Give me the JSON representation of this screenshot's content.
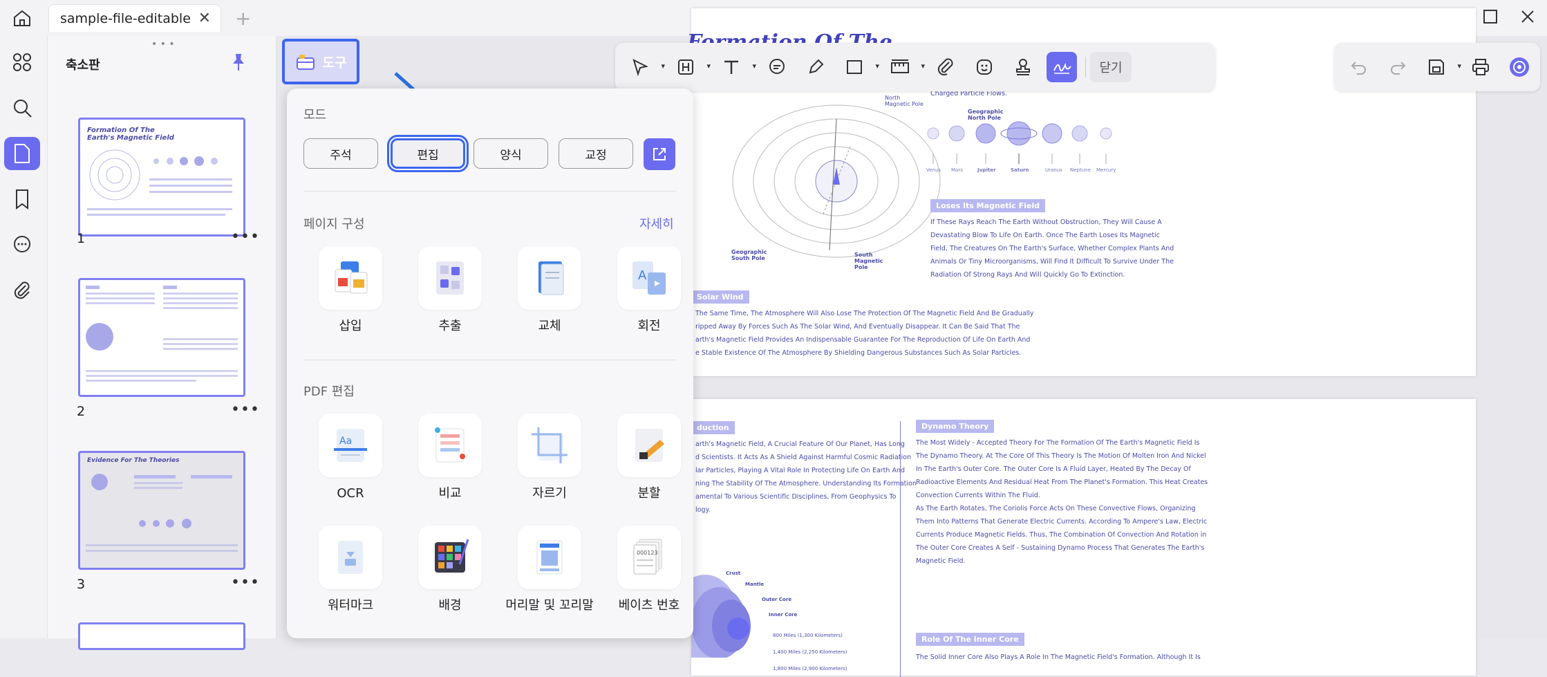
{
  "tab": {
    "title": "sample-file-editable"
  },
  "sidebar": {
    "title": "축소판"
  },
  "thumbnails": [
    {
      "num": "1"
    },
    {
      "num": "2"
    },
    {
      "num": "3"
    }
  ],
  "tools_button": {
    "label": "도구"
  },
  "toolbar": {
    "close_label": "닫기"
  },
  "popup": {
    "mode_title": "모드",
    "modes": [
      "주석",
      "편집",
      "양식",
      "교정"
    ],
    "page_section": "페이지 구성",
    "details_link": "자세히",
    "page_items": [
      "삽입",
      "추출",
      "교체",
      "회전"
    ],
    "pdf_section": "PDF 편집",
    "pdf_items": [
      "OCR",
      "비교",
      "자르기",
      "분할"
    ],
    "pdf_items2": [
      "워터마크",
      "배경",
      "머리말 및 꼬리말",
      "베이츠 번호"
    ]
  },
  "doc": {
    "page1_title": "Formation Of The",
    "north_pole": "North\nMagnetic Pole",
    "geo_north": "Geographic\nNorth Pole",
    "geo_south": "Geographic\nSouth Pole",
    "south_pole": "South\nMagnetic\nPole",
    "charged": "Charged Particle Flows.",
    "planets": [
      "Venus",
      "Mars",
      "Jupiter",
      "Saturn",
      "Uranus",
      "Neptune",
      "Mercury"
    ],
    "loses_label": "Loses Its Magnetic Field",
    "loses_text": [
      "If These Rays Reach The Earth Without Obstruction, They Will Cause A",
      "Devastating Blow To Life On Earth. Once The Earth Loses Its Magnetic",
      "Field, The Creatures On The Earth's Surface, Whether Complex Plants And",
      "Animals Or Tiny Microorganisms, Will Find It Difficult To Survive Under The",
      "Radiation Of Strong Rays And Will Quickly Go To Extinction."
    ],
    "solar_label": "Solar Wind",
    "solar_text": [
      "The Same Time, The Atmosphere Will Also Lose The Protection Of The Magnetic Field And Be Gradually",
      "ripped Away By Forces Such As The Solar Wind, And Eventually Disappear. It Can Be Said That The",
      "arth's Magnetic Field Provides An Indispensable Guarantee For The Reproduction Of Life On Earth And",
      "e Stable Existence Of The Atmosphere By Shielding Dangerous Substances Such As Solar Particles."
    ],
    "intro_label": "duction",
    "intro_text": [
      "arth's Magnetic Field, A Crucial Feature Of Our Planet, Has Long",
      "d Scientists. It Acts As A Shield Against Harmful Cosmic Radiation",
      "lar Particles, Playing A Vital Role In Protecting Life On Earth And",
      "ning The Stability Of The Atmosphere. Understanding Its Formation",
      "amental To Various Scientific Disciplines, From Geophysics To",
      "logy."
    ],
    "layers": [
      "Crust",
      "Mantle",
      "Outer Core",
      "Inner Core",
      "800 Miles (1,300 Kilometers)",
      "1,400 Miles (2,250 Kilometers)",
      "1,800 Miles (2,900 Kilometers)"
    ],
    "dynamo_label": "Dynamo Theory",
    "dynamo_text": [
      "The Most Widely - Accepted Theory For The Formation Of The Earth's Magnetic Field Is",
      "The Dynamo Theory. At The Core Of This Theory Is The Motion Of Molten Iron And Nickel",
      "In The Earth's Outer Core. The Outer Core Is A Fluid Layer, Heated By The Decay Of",
      "Radioactive Elements And Residual Heat From The Planet's Formation. This Heat Creates",
      "Convection Currents Within The Fluid.",
      "As The Earth Rotates, The Coriolis Force Acts On These Convective Flows, Organizing",
      "Them Into Patterns That Generate Electric Currents. According To Ampere's Law, Electric",
      "Currents Produce Magnetic Fields. Thus, The Combination Of Convection And Rotation in",
      "The Outer Core Creates A Self - Sustaining Dynamo Process That Generates The Earth's",
      "Magnetic Field."
    ],
    "inner_label": "Role Of The Inner Core",
    "inner_text": "The Solid Inner Core Also Plays A Role In The Magnetic Field's Formation. Although It Is"
  }
}
